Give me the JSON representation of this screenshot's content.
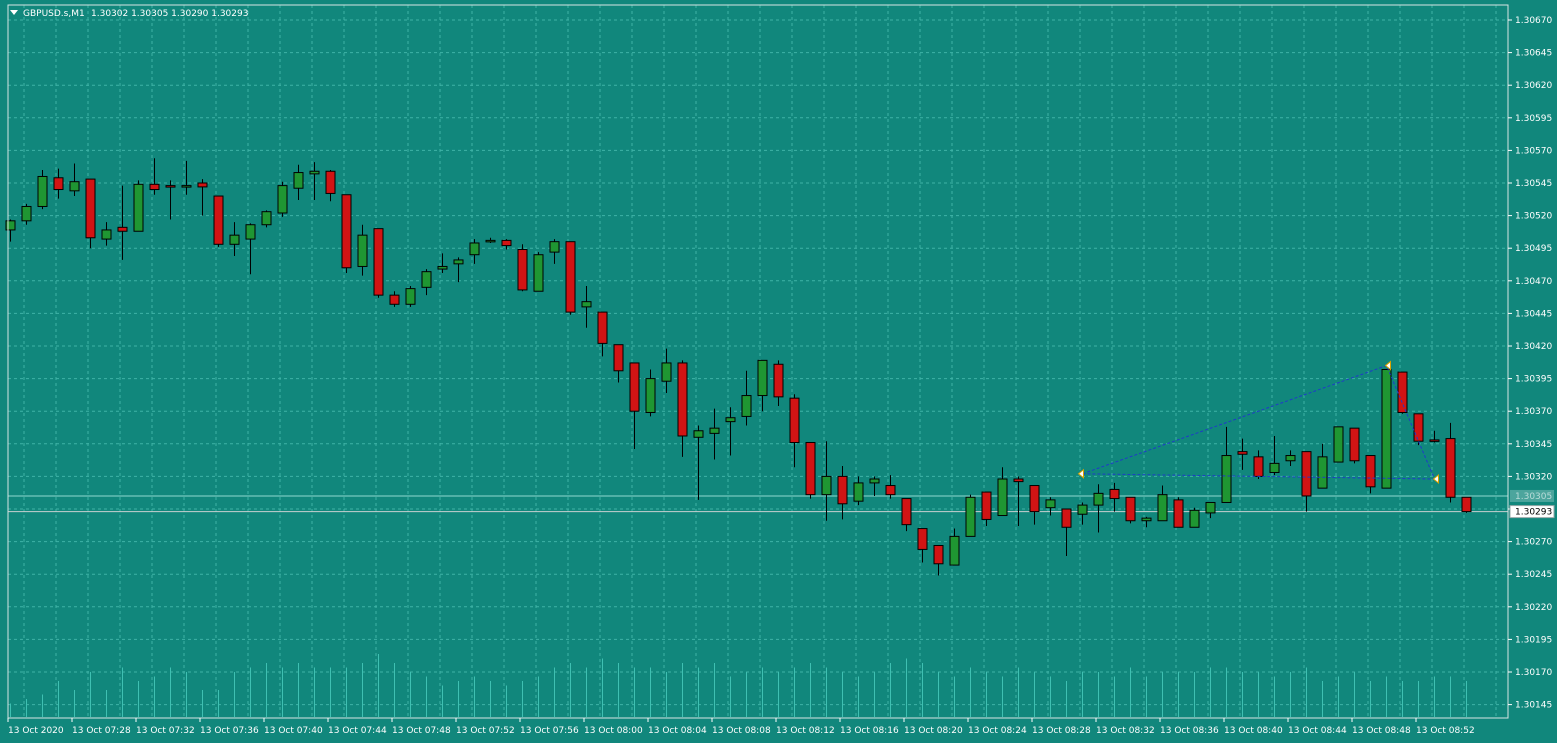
{
  "header": {
    "symbol": "GBPUSD.s,M1",
    "ohlc": "1.30302 1.30305 1.30290 1.30293"
  },
  "colors": {
    "background": "#11877c",
    "grid": "#3fb3a6",
    "bull": "#1f9632",
    "bear": "#d11414",
    "wick": "#000000",
    "volume": "#3fc0b2",
    "drawing": "#1f3cc7",
    "price_tag_bg": "#ffffff",
    "text": "#ffffff"
  },
  "chart_data": {
    "type": "candlestick",
    "title": "GBPUSD.s,M1",
    "ylim": [
      1.30145,
      1.3067
    ],
    "y_ticks": [
      "1.30670",
      "1.30645",
      "1.30620",
      "1.30595",
      "1.30570",
      "1.30545",
      "1.30520",
      "1.30495",
      "1.30470",
      "1.30445",
      "1.30420",
      "1.30395",
      "1.30370",
      "1.30345",
      "1.30320",
      "1.30295",
      "1.30270",
      "1.30245",
      "1.30220",
      "1.30195",
      "1.30170",
      "1.30145"
    ],
    "x_labels": [
      "13 Oct 2020",
      "13 Oct 07:28",
      "13 Oct 07:32",
      "13 Oct 07:36",
      "13 Oct 07:40",
      "13 Oct 07:44",
      "13 Oct 07:48",
      "13 Oct 07:52",
      "13 Oct 07:56",
      "13 Oct 08:00",
      "13 Oct 08:04",
      "13 Oct 08:08",
      "13 Oct 08:12",
      "13 Oct 08:16",
      "13 Oct 08:20",
      "13 Oct 08:24",
      "13 Oct 08:28",
      "13 Oct 08:32",
      "13 Oct 08:36",
      "13 Oct 08:40",
      "13 Oct 08:44",
      "13 Oct 08:48",
      "13 Oct 08:52"
    ],
    "candles": [
      {
        "o": 1.30509,
        "h": 1.30517,
        "l": 1.305,
        "c": 1.30516
      },
      {
        "o": 1.30516,
        "h": 1.30529,
        "l": 1.30513,
        "c": 1.30527
      },
      {
        "o": 1.30527,
        "h": 1.30555,
        "l": 1.30525,
        "c": 1.3055
      },
      {
        "o": 1.30549,
        "h": 1.30556,
        "l": 1.30533,
        "c": 1.3054
      },
      {
        "o": 1.30539,
        "h": 1.3056,
        "l": 1.30535,
        "c": 1.30546
      },
      {
        "o": 1.30548,
        "h": 1.30548,
        "l": 1.30495,
        "c": 1.30503
      },
      {
        "o": 1.30502,
        "h": 1.30515,
        "l": 1.30497,
        "c": 1.30509
      },
      {
        "o": 1.30511,
        "h": 1.30543,
        "l": 1.30486,
        "c": 1.30508
      },
      {
        "o": 1.30508,
        "h": 1.30547,
        "l": 1.30508,
        "c": 1.30544
      },
      {
        "o": 1.30544,
        "h": 1.30564,
        "l": 1.30536,
        "c": 1.3054
      },
      {
        "o": 1.30543,
        "h": 1.30547,
        "l": 1.30517,
        "c": 1.30542
      },
      {
        "o": 1.30543,
        "h": 1.30562,
        "l": 1.30536,
        "c": 1.30543
      },
      {
        "o": 1.30545,
        "h": 1.30548,
        "l": 1.3052,
        "c": 1.30542
      },
      {
        "o": 1.30535,
        "h": 1.30535,
        "l": 1.30496,
        "c": 1.30498
      },
      {
        "o": 1.30498,
        "h": 1.30515,
        "l": 1.30489,
        "c": 1.30505
      },
      {
        "o": 1.30502,
        "h": 1.30514,
        "l": 1.30475,
        "c": 1.30513
      },
      {
        "o": 1.30513,
        "h": 1.30524,
        "l": 1.30511,
        "c": 1.30523
      },
      {
        "o": 1.30522,
        "h": 1.30546,
        "l": 1.30519,
        "c": 1.30543
      },
      {
        "o": 1.30541,
        "h": 1.30559,
        "l": 1.30532,
        "c": 1.30553
      },
      {
        "o": 1.30552,
        "h": 1.30561,
        "l": 1.30532,
        "c": 1.30554
      },
      {
        "o": 1.30554,
        "h": 1.30555,
        "l": 1.30531,
        "c": 1.30537
      },
      {
        "o": 1.30536,
        "h": 1.30536,
        "l": 1.30476,
        "c": 1.3048
      },
      {
        "o": 1.30481,
        "h": 1.30513,
        "l": 1.30474,
        "c": 1.30505
      },
      {
        "o": 1.3051,
        "h": 1.3051,
        "l": 1.30457,
        "c": 1.30459
      },
      {
        "o": 1.30459,
        "h": 1.30462,
        "l": 1.3045,
        "c": 1.30452
      },
      {
        "o": 1.30452,
        "h": 1.30466,
        "l": 1.3045,
        "c": 1.30464
      },
      {
        "o": 1.30465,
        "h": 1.30479,
        "l": 1.30459,
        "c": 1.30477
      },
      {
        "o": 1.30479,
        "h": 1.30491,
        "l": 1.30476,
        "c": 1.30481
      },
      {
        "o": 1.30483,
        "h": 1.30488,
        "l": 1.30469,
        "c": 1.30486
      },
      {
        "o": 1.3049,
        "h": 1.30502,
        "l": 1.30483,
        "c": 1.30499
      },
      {
        "o": 1.30501,
        "h": 1.30503,
        "l": 1.30499,
        "c": 1.30501
      },
      {
        "o": 1.30501,
        "h": 1.30502,
        "l": 1.30494,
        "c": 1.30497
      },
      {
        "o": 1.30494,
        "h": 1.30498,
        "l": 1.30462,
        "c": 1.30463
      },
      {
        "o": 1.30462,
        "h": 1.30492,
        "l": 1.30462,
        "c": 1.3049
      },
      {
        "o": 1.30492,
        "h": 1.30502,
        "l": 1.30483,
        "c": 1.305
      },
      {
        "o": 1.305,
        "h": 1.305,
        "l": 1.30444,
        "c": 1.30446
      },
      {
        "o": 1.3045,
        "h": 1.30466,
        "l": 1.30434,
        "c": 1.30454
      },
      {
        "o": 1.30446,
        "h": 1.30446,
        "l": 1.30412,
        "c": 1.30422
      },
      {
        "o": 1.30421,
        "h": 1.30421,
        "l": 1.30392,
        "c": 1.30401
      },
      {
        "o": 1.30407,
        "h": 1.30407,
        "l": 1.30341,
        "c": 1.3037
      },
      {
        "o": 1.30369,
        "h": 1.30402,
        "l": 1.30366,
        "c": 1.30395
      },
      {
        "o": 1.30393,
        "h": 1.30418,
        "l": 1.30384,
        "c": 1.30407
      },
      {
        "o": 1.30407,
        "h": 1.30409,
        "l": 1.30335,
        "c": 1.30351
      },
      {
        "o": 1.3035,
        "h": 1.30359,
        "l": 1.30302,
        "c": 1.30355
      },
      {
        "o": 1.30353,
        "h": 1.30372,
        "l": 1.30333,
        "c": 1.30357
      },
      {
        "o": 1.30362,
        "h": 1.30373,
        "l": 1.30336,
        "c": 1.30365
      },
      {
        "o": 1.30366,
        "h": 1.30401,
        "l": 1.30359,
        "c": 1.30382
      },
      {
        "o": 1.30382,
        "h": 1.30409,
        "l": 1.3037,
        "c": 1.30409
      },
      {
        "o": 1.30406,
        "h": 1.30409,
        "l": 1.30374,
        "c": 1.30381
      },
      {
        "o": 1.3038,
        "h": 1.30383,
        "l": 1.30327,
        "c": 1.30346
      },
      {
        "o": 1.30346,
        "h": 1.30346,
        "l": 1.30303,
        "c": 1.30306
      },
      {
        "o": 1.30306,
        "h": 1.30347,
        "l": 1.30286,
        "c": 1.3032
      },
      {
        "o": 1.3032,
        "h": 1.30328,
        "l": 1.30287,
        "c": 1.30299
      },
      {
        "o": 1.30301,
        "h": 1.3032,
        "l": 1.30298,
        "c": 1.30315
      },
      {
        "o": 1.30315,
        "h": 1.3032,
        "l": 1.30305,
        "c": 1.30318
      },
      {
        "o": 1.30313,
        "h": 1.30321,
        "l": 1.30303,
        "c": 1.30306
      },
      {
        "o": 1.30303,
        "h": 1.30303,
        "l": 1.30278,
        "c": 1.30283
      },
      {
        "o": 1.3028,
        "h": 1.3028,
        "l": 1.30254,
        "c": 1.30264
      },
      {
        "o": 1.30267,
        "h": 1.30267,
        "l": 1.30244,
        "c": 1.30253
      },
      {
        "o": 1.30252,
        "h": 1.3028,
        "l": 1.30252,
        "c": 1.30274
      },
      {
        "o": 1.30274,
        "h": 1.30306,
        "l": 1.30274,
        "c": 1.30304
      },
      {
        "o": 1.30308,
        "h": 1.30308,
        "l": 1.30282,
        "c": 1.30287
      },
      {
        "o": 1.3029,
        "h": 1.30327,
        "l": 1.3029,
        "c": 1.30318
      },
      {
        "o": 1.30318,
        "h": 1.3032,
        "l": 1.30282,
        "c": 1.30316
      },
      {
        "o": 1.30313,
        "h": 1.30313,
        "l": 1.30283,
        "c": 1.30293
      },
      {
        "o": 1.30296,
        "h": 1.30304,
        "l": 1.3029,
        "c": 1.30302
      },
      {
        "o": 1.30295,
        "h": 1.30295,
        "l": 1.30259,
        "c": 1.30281
      },
      {
        "o": 1.30291,
        "h": 1.303,
        "l": 1.30283,
        "c": 1.30298
      },
      {
        "o": 1.30298,
        "h": 1.30314,
        "l": 1.30277,
        "c": 1.30307
      },
      {
        "o": 1.3031,
        "h": 1.30315,
        "l": 1.30293,
        "c": 1.30303
      },
      {
        "o": 1.30304,
        "h": 1.30304,
        "l": 1.30284,
        "c": 1.30286
      },
      {
        "o": 1.30286,
        "h": 1.30289,
        "l": 1.30281,
        "c": 1.30288
      },
      {
        "o": 1.30286,
        "h": 1.30313,
        "l": 1.30286,
        "c": 1.30306
      },
      {
        "o": 1.30302,
        "h": 1.30304,
        "l": 1.30281,
        "c": 1.30281
      },
      {
        "o": 1.30281,
        "h": 1.30296,
        "l": 1.30281,
        "c": 1.30294
      },
      {
        "o": 1.30292,
        "h": 1.303,
        "l": 1.30288,
        "c": 1.303
      },
      {
        "o": 1.303,
        "h": 1.30358,
        "l": 1.303,
        "c": 1.30336
      },
      {
        "o": 1.30339,
        "h": 1.30349,
        "l": 1.30325,
        "c": 1.30337
      },
      {
        "o": 1.30335,
        "h": 1.3034,
        "l": 1.30318,
        "c": 1.3032
      },
      {
        "o": 1.30323,
        "h": 1.30351,
        "l": 1.30321,
        "c": 1.3033
      },
      {
        "o": 1.30332,
        "h": 1.3034,
        "l": 1.30328,
        "c": 1.30336
      },
      {
        "o": 1.30339,
        "h": 1.30339,
        "l": 1.30293,
        "c": 1.30305
      },
      {
        "o": 1.30311,
        "h": 1.30345,
        "l": 1.30311,
        "c": 1.30335
      },
      {
        "o": 1.30331,
        "h": 1.30358,
        "l": 1.30331,
        "c": 1.30358
      },
      {
        "o": 1.30357,
        "h": 1.30357,
        "l": 1.3033,
        "c": 1.30332
      },
      {
        "o": 1.30336,
        "h": 1.30336,
        "l": 1.30307,
        "c": 1.30312
      },
      {
        "o": 1.30311,
        "h": 1.30402,
        "l": 1.30311,
        "c": 1.30402
      },
      {
        "o": 1.304,
        "h": 1.304,
        "l": 1.30368,
        "c": 1.30369
      },
      {
        "o": 1.30368,
        "h": 1.30368,
        "l": 1.30344,
        "c": 1.30347
      },
      {
        "o": 1.30348,
        "h": 1.30355,
        "l": 1.30346,
        "c": 1.30347
      },
      {
        "o": 1.30349,
        "h": 1.30361,
        "l": 1.303,
        "c": 1.30304
      },
      {
        "o": 1.30304,
        "h": 1.30304,
        "l": 1.30292,
        "c": 1.30293
      }
    ],
    "volumes": [
      0.15,
      0.2,
      0.25,
      0.4,
      0.3,
      0.5,
      0.3,
      0.55,
      0.4,
      0.45,
      0.55,
      0.5,
      0.3,
      0.3,
      0.5,
      0.55,
      0.6,
      0.55,
      0.6,
      0.55,
      0.55,
      0.55,
      0.6,
      0.7,
      0.6,
      0.5,
      0.45,
      0.35,
      0.4,
      0.45,
      0.4,
      0.35,
      0.4,
      0.45,
      0.55,
      0.6,
      0.55,
      0.65,
      0.6,
      0.55,
      0.55,
      0.5,
      0.6,
      0.55,
      0.6,
      0.45,
      0.5,
      0.55,
      0.5,
      0.55,
      0.6,
      0.55,
      0.5,
      0.45,
      0.5,
      0.6,
      0.65,
      0.6,
      0.5,
      0.45,
      0.55,
      0.5,
      0.45,
      0.55,
      0.5,
      0.45,
      0.4,
      0.5,
      0.5,
      0.45,
      0.55,
      0.45,
      0.5,
      0.5,
      0.5,
      0.55,
      0.55,
      0.5,
      0.5,
      0.45,
      0.5,
      0.55,
      0.4,
      0.45,
      0.5,
      0.4,
      0.45,
      0.4,
      0.4,
      0.45,
      0.45,
      0.4
    ],
    "current_price": 1.30293,
    "ask_price": 1.30305,
    "current_price_label": "1.30293",
    "ask_price_label": "1.30305",
    "pattern": {
      "points": [
        {
          "candle": 67,
          "price": 1.30322
        },
        {
          "candle": 86,
          "price": 1.30405
        },
        {
          "candle": 89,
          "price": 1.30318
        },
        {
          "candle": 67,
          "price": 1.30322
        }
      ]
    },
    "grid": true
  }
}
